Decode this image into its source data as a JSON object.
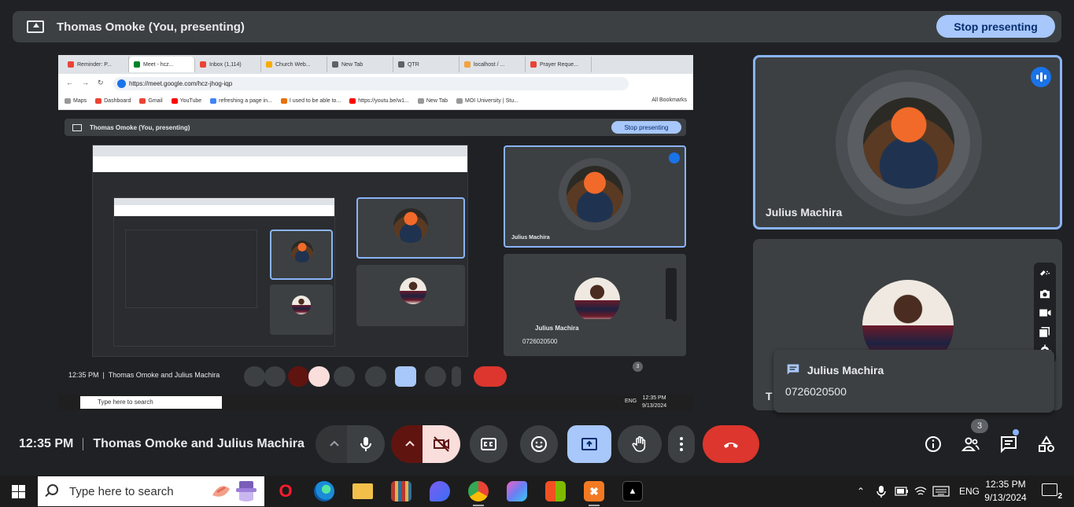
{
  "presenting_bar": {
    "title": "Thomas Omoke (You, presenting)",
    "stop_label": "Stop presenting"
  },
  "shared_screen": {
    "browser_tabs": [
      "Reminder: P...",
      "Meet - hcz...",
      "Inbox (1,114)",
      "Church Web...",
      "New Tab",
      "QTR",
      "localhost / ...",
      "Prayer Reque..."
    ],
    "url": "https://meet.google.com/hcz-jhog-iqp",
    "bookmarks": [
      "Maps",
      "Dashboard",
      "Gmail",
      "YouTube",
      "refreshing a page in...",
      "I used to be able to...",
      "https://youtu.be/w1...",
      "New Tab",
      "MOI University | Stu..."
    ],
    "all_bookmarks": "All Bookmarks",
    "inner_present_title": "Thomas Omoke (You, presenting)",
    "inner_stop_label": "Stop presenting",
    "inner_tile1_name": "Julius Machira",
    "inner_chat_name": "Julius Machira",
    "inner_chat_msg": "0726020500",
    "inner_time": "12:35 PM",
    "inner_meeting": "Thomas Omoke and Julius Machira",
    "inner_badge": "3",
    "inner_search": "Type here to search",
    "inner_lang": "ENG",
    "inner_clock_time": "12:35 PM",
    "inner_clock_date": "9/13/2024"
  },
  "tiles": [
    {
      "name": "Julius Machira",
      "speaking": true
    },
    {
      "name": "T",
      "speaking": false
    }
  ],
  "chat_notification": {
    "sender": "Julius Machira",
    "message": "0726020500"
  },
  "controls": {
    "time": "12:35 PM",
    "meeting_title": "Thomas Omoke and Julius Machira",
    "people_count": "3"
  },
  "taskbar": {
    "search_placeholder": "Type here to search",
    "lang": "ENG",
    "clock_time": "12:35 PM",
    "clock_date": "9/13/2024",
    "notification_count": "2"
  },
  "colors": {
    "accent": "#a8c7fa",
    "leave": "#dc362e",
    "active_border": "#8ab4f8",
    "background": "#202124"
  }
}
